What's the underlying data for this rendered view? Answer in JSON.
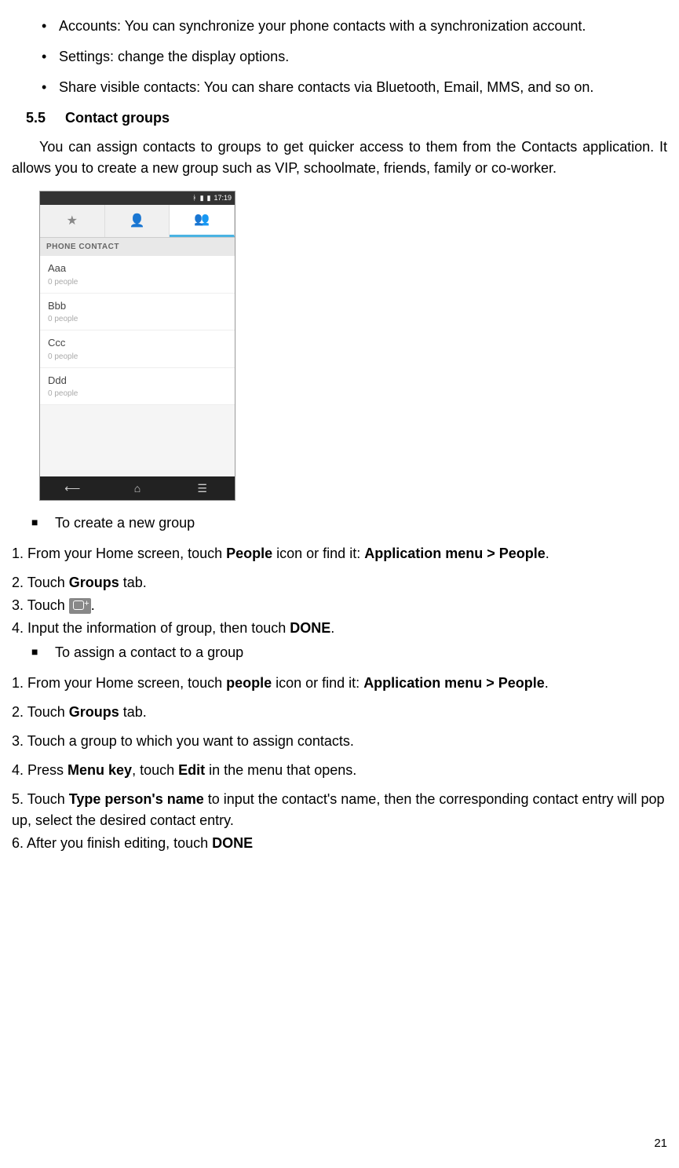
{
  "bullets": [
    "Accounts: You can synchronize your phone contacts with a synchronization account.",
    "Settings: change the display options.",
    "Share visible contacts: You can share contacts via Bluetooth, Email, MMS, and so on."
  ],
  "section": {
    "num": "5.5",
    "title": "Contact groups"
  },
  "section_para": "You can assign contacts to groups to get quicker access to them from the Contacts application. It allows you to create a new group such as VIP, schoolmate, friends, family or co-worker.",
  "phone": {
    "time": "17:19",
    "section_label": "PHONE CONTACT",
    "groups": [
      {
        "name": "Aaa",
        "sub": "0 people"
      },
      {
        "name": "Bbb",
        "sub": "0 people"
      },
      {
        "name": "Ccc",
        "sub": "0 people"
      },
      {
        "name": "Ddd",
        "sub": "0 people"
      }
    ]
  },
  "sub1_title": "To create a new group",
  "sub1_steps": {
    "s1_a": "1. From your Home screen, touch ",
    "s1_b": "People",
    "s1_c": " icon or find it: ",
    "s1_d": "Application menu > People",
    "s1_e": ".",
    "s2_a": "2. Touch ",
    "s2_b": "Groups",
    "s2_c": " tab.",
    "s3_a": "3. Touch ",
    "s3_b": ".",
    "s4_a": "4. Input the information of group, then touch ",
    "s4_b": "DONE",
    "s4_c": "."
  },
  "sub2_title": "To assign a contact to a group",
  "sub2_steps": {
    "s1_a": "1. From your Home screen, touch ",
    "s1_b": "people",
    "s1_c": " icon or find it: ",
    "s1_d": "Application menu > People",
    "s1_e": ".",
    "s2_a": "2. Touch ",
    "s2_b": "Groups",
    "s2_c": " tab.",
    "s3": "3. Touch a group to which you want to assign contacts.",
    "s4_a": "4. Press ",
    "s4_b": "Menu key",
    "s4_c": ", touch ",
    "s4_d": "Edit",
    "s4_e": " in the menu that opens.",
    "s5_a": "5. Touch ",
    "s5_b": "Type person's name",
    "s5_c": " to input the contact's name, then the corresponding contact entry will pop up, select the desired contact entry.",
    "s6_a": "6. After you finish editing, touch ",
    "s6_b": "DONE"
  },
  "page_number": "21"
}
